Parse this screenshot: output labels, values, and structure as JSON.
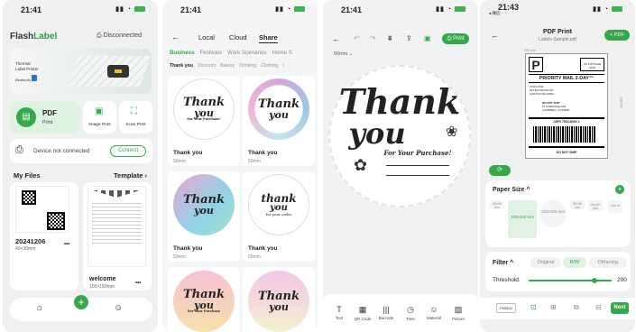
{
  "colors": {
    "accent": "#36a74b",
    "danger": "#e03b3b"
  },
  "p1": {
    "time": "21:41",
    "logo_a": "Flash",
    "logo_b": "Label",
    "status": "Disconnected",
    "banner_line1": "Thermal",
    "banner_line2": "Label Printer",
    "banner_bt": "Bluetooth",
    "pdf_title": "PDF",
    "pdf_sub": "Print",
    "image_print": "Image Print",
    "scan_print": "Scan Print",
    "device": "Device not connected",
    "connect": "Connect",
    "my_files": "My Files",
    "template": "Template",
    "file1_name": "20241206",
    "file1_size": "40×30mm",
    "file2_name": "welcome",
    "file2_size": "100×150mm",
    "more": "•••",
    "fab": "+"
  },
  "p2": {
    "time": "21:41",
    "tabs": [
      "Local",
      "Cloud",
      "Share"
    ],
    "categories": [
      "Business",
      "Festivals",
      "Work Scenarios",
      "Home S"
    ],
    "subcats": [
      "Thank you",
      "Discount",
      "Bakery",
      "Drinking",
      "Clothing",
      "I"
    ],
    "cards": [
      {
        "title": "Thank you",
        "size": "50mm",
        "t1": "Thank",
        "t2": "you",
        "t3": "For Your Purchase!"
      },
      {
        "title": "Thank you",
        "size": "50mm",
        "t1": "Thank",
        "t2": "you",
        "t3": ""
      },
      {
        "title": "Thank you",
        "size": "50mm",
        "t1": "Thank",
        "t2": "you",
        "t3": ""
      },
      {
        "title": "Thank you",
        "size": "50mm",
        "t1": "thank",
        "t2": "you",
        "t3": "for your order"
      },
      {
        "title": "",
        "size": "",
        "t1": "Thank",
        "t2": "you",
        "t3": "For Your Purchase"
      },
      {
        "title": "",
        "size": "",
        "t1": "Thank",
        "t2": "you",
        "t3": ""
      }
    ]
  },
  "p3": {
    "time": "21:41",
    "print": "Print",
    "size": "50mm",
    "label_t1": "Thank",
    "label_t2": "you",
    "label_t3": "For Your Purchase!",
    "tools": [
      "Text",
      "QR Code",
      "Barcode",
      "Time",
      "Material",
      "Picture"
    ]
  },
  "p4": {
    "time": "21:43",
    "back_label": "◂ 微信",
    "title": "PDF Print",
    "subtitle": "Labels-Sample.pdf",
    "add_pdf": "+ PDF",
    "lbl_p": "P",
    "lbl_priority": "PRIORITY MAIL 2-DAY™",
    "lbl_ps": "US POSTAGE PAID",
    "lbl_tracking": "USPS TRACKING #",
    "lbl_dns": "DO NOT SHIP",
    "lbl_from1": "JOHN DOE",
    "lbl_from2": "234 BAYWOOD RD",
    "lbl_from3": "CANTON MA 02021",
    "lbl_to1": "DO NOT SHIP",
    "lbl_to2": "11 CARRIAGE AVE",
    "lbl_to3": "CAMPBELL CA 95008",
    "dim_top": "100 mm",
    "dim_side": "150 mm",
    "paper_size": "Paper Size",
    "sizes": [
      "40x30 mm",
      "100x150 mm",
      "100x100 mm",
      "50x30 mm",
      "60x40 mm",
      "4x6 in"
    ],
    "filter": "Filter",
    "filters": [
      "Original",
      "B/W",
      "Dithering"
    ],
    "threshold_label": "Threshold:",
    "threshold": "200",
    "next": "Next",
    "fnskc": "FNSKU"
  }
}
